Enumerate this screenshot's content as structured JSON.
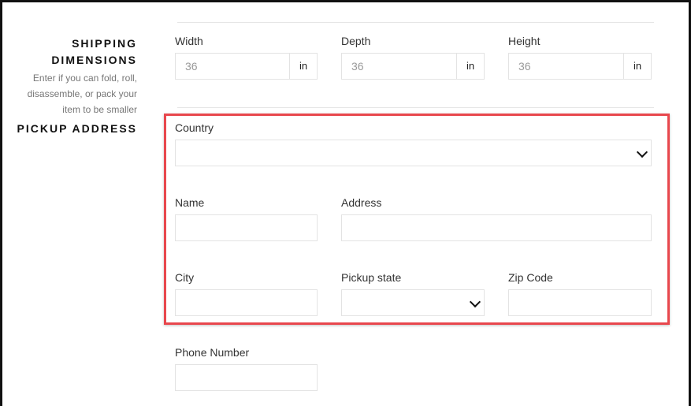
{
  "shipping_dimensions": {
    "title_line1": "SHIPPING",
    "title_line2": "DIMENSIONS",
    "help_line1": "Enter if you can fold, roll,",
    "help_line2": "disassemble, or pack your",
    "help_line3": "item to be smaller",
    "width": {
      "label": "Width",
      "value": "36",
      "unit": "in"
    },
    "depth": {
      "label": "Depth",
      "value": "36",
      "unit": "in"
    },
    "height": {
      "label": "Height",
      "value": "36",
      "unit": "in"
    }
  },
  "pickup_address": {
    "title": "PICKUP ADDRESS",
    "country": {
      "label": "Country",
      "value": ""
    },
    "name": {
      "label": "Name",
      "value": ""
    },
    "address": {
      "label": "Address",
      "value": ""
    },
    "city": {
      "label": "City",
      "value": ""
    },
    "pickup_state": {
      "label": "Pickup state",
      "value": ""
    },
    "zip_code": {
      "label": "Zip Code",
      "value": ""
    },
    "phone_number": {
      "label": "Phone Number",
      "value": ""
    }
  },
  "highlight_color": "#e8474d",
  "icons": {
    "select_arrow": "chevron-down-icon"
  }
}
